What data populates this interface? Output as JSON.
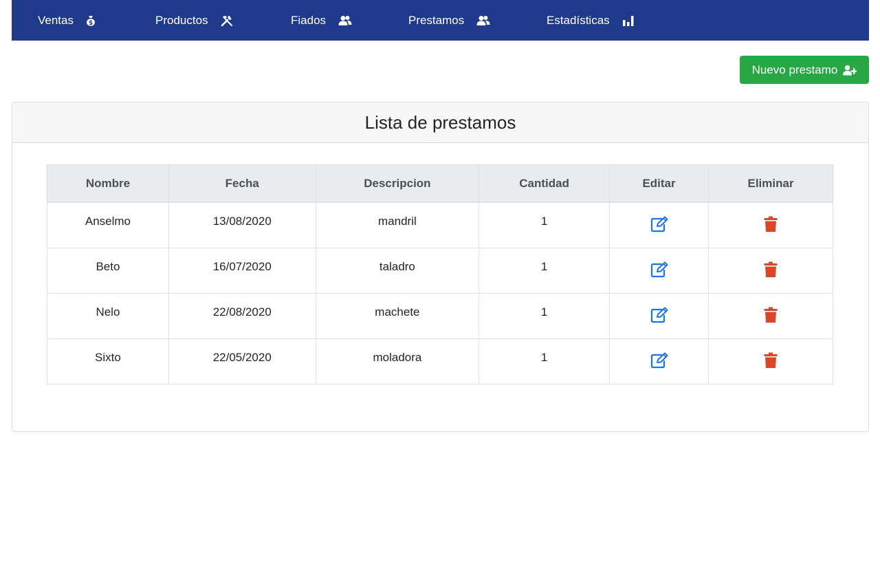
{
  "nav": {
    "items": [
      {
        "label": "Ventas",
        "icon": "money-bag-icon"
      },
      {
        "label": "Productos",
        "icon": "tools-icon"
      },
      {
        "label": "Fiados",
        "icon": "users-icon"
      },
      {
        "label": "Prestamos",
        "icon": "users-icon"
      },
      {
        "label": "Estadísticas",
        "icon": "bar-chart-icon"
      }
    ]
  },
  "actions": {
    "new_loan_label": "Nuevo prestamo",
    "new_loan_icon": "user-plus-icon"
  },
  "card": {
    "title": "Lista de prestamos"
  },
  "table": {
    "headers": [
      "Nombre",
      "Fecha",
      "Descripcion",
      "Cantidad",
      "Editar",
      "Eliminar"
    ],
    "rows": [
      {
        "nombre": "Anselmo",
        "fecha": "13/08/2020",
        "descripcion": "mandril",
        "cantidad": "1"
      },
      {
        "nombre": "Beto",
        "fecha": "16/07/2020",
        "descripcion": "taladro",
        "cantidad": "1"
      },
      {
        "nombre": "Nelo",
        "fecha": "22/08/2020",
        "descripcion": "machete",
        "cantidad": "1"
      },
      {
        "nombre": "Sixto",
        "fecha": "22/05/2020",
        "descripcion": "moladora",
        "cantidad": "1"
      }
    ]
  },
  "colors": {
    "navbar": "#1f3a8a",
    "success": "#28a745",
    "edit": "#1a73e8",
    "delete": "#d9472b"
  }
}
